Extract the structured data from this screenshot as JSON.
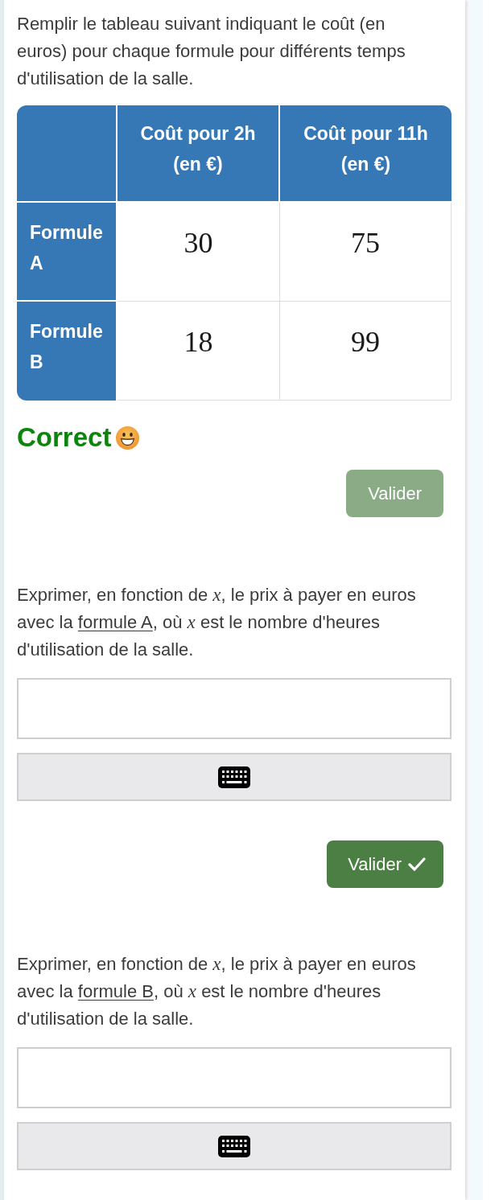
{
  "sections": [
    {
      "kind": "table",
      "prompt": [
        {
          "kind": "text",
          "text": "Remplir le tableau suivant indiquant le coût (en euros) pour chaque formule pour différents temps d'utilisation de la salle."
        }
      ],
      "table": {
        "columns": [
          "Coût pour 2h (en €)",
          "Coût pour 11h (en €)"
        ],
        "rows": [
          {
            "label": "Formule A",
            "values": [
              "30",
              "75"
            ]
          },
          {
            "label": "Formule B",
            "values": [
              "18",
              "99"
            ]
          }
        ]
      },
      "feedback": {
        "text": "Correct",
        "correct": true
      },
      "button": {
        "label": "Valider",
        "disabled": true,
        "checkmark": false
      }
    },
    {
      "kind": "expression",
      "prompt": [
        {
          "kind": "text",
          "text": "Exprimer, en fonction de "
        },
        {
          "kind": "math",
          "text": "x"
        },
        {
          "kind": "text",
          "text": ", le prix à payer en euros avec la "
        },
        {
          "kind": "underline",
          "text": "formule A"
        },
        {
          "kind": "text",
          "text": ", où "
        },
        {
          "kind": "math",
          "text": "x"
        },
        {
          "kind": "text",
          "text": " est le nombre d'heures d'utilisation de la salle."
        }
      ],
      "button": {
        "label": "Valider",
        "disabled": false,
        "checkmark": true
      }
    },
    {
      "kind": "expression",
      "prompt": [
        {
          "kind": "text",
          "text": "Exprimer, en fonction de "
        },
        {
          "kind": "math",
          "text": "x"
        },
        {
          "kind": "text",
          "text": ", le prix à payer en euros avec la "
        },
        {
          "kind": "underline",
          "text": "formule B"
        },
        {
          "kind": "text",
          "text": ", où "
        },
        {
          "kind": "math",
          "text": "x"
        },
        {
          "kind": "text",
          "text": " est le nombre d'heures d'utilisation de la salle."
        }
      ]
    }
  ]
}
